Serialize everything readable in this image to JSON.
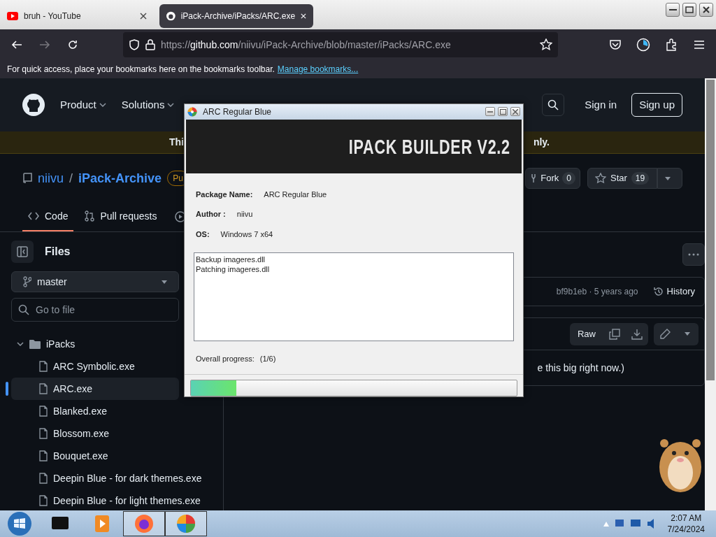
{
  "browser": {
    "tabs": [
      {
        "title": "bruh - YouTube",
        "selected": false
      },
      {
        "title": "iPack-Archive/iPacks/ARC.exe",
        "selected": true
      }
    ],
    "forward_disabled": true,
    "url": {
      "scheme": "https://",
      "host": "github.com",
      "path": "/niivu/iPack-Archive/blob/master/iPacks/ARC.exe"
    },
    "bookmarks_bar": {
      "message": "For quick access, place your bookmarks here on the bookmarks toolbar.",
      "link": "Manage bookmarks..."
    }
  },
  "github": {
    "nav": [
      {
        "label": "Product"
      },
      {
        "label": "Solutions"
      }
    ],
    "sign_in": "Sign in",
    "sign_up": "Sign up",
    "banner": {
      "text_start": "Thi",
      "text_end": "nly."
    },
    "repo": {
      "owner": "niivu",
      "separator": "/",
      "name": "iPack-Archive",
      "visibility": "Pu",
      "fork": {
        "label": "Fork",
        "count": "0"
      },
      "star": {
        "label": "Star",
        "count": "19"
      }
    },
    "tabs": [
      {
        "label": "Code",
        "selected": true
      },
      {
        "label": "Pull requests",
        "selected": false
      }
    ],
    "sidebar": {
      "title": "Files",
      "branch": "master",
      "search_placeholder": "Go to file",
      "tree": [
        {
          "name": "iPacks",
          "kind": "folder",
          "expanded": true,
          "selected": false,
          "children": [
            {
              "name": "ARC Symbolic.exe",
              "kind": "file",
              "selected": false
            },
            {
              "name": "ARC.exe",
              "kind": "file",
              "selected": true
            },
            {
              "name": "Blanked.exe",
              "kind": "file",
              "selected": false
            },
            {
              "name": "Blossom.exe",
              "kind": "file",
              "selected": false
            },
            {
              "name": "Bouquet.exe",
              "kind": "file",
              "selected": false
            },
            {
              "name": "Deepin Blue - for dark themes.exe",
              "kind": "file",
              "selected": false
            },
            {
              "name": "Deepin Blue - for light themes.exe",
              "kind": "file",
              "selected": false
            }
          ]
        }
      ]
    },
    "commit": {
      "text": "bf9b1eb · 5 years ago",
      "history": "History"
    },
    "file_toolbar": {
      "raw": "Raw"
    },
    "file_message": "e this big right now.)"
  },
  "dialog": {
    "title": "ARC Regular Blue",
    "banner": "IPACK BUILDER V2.2",
    "fields": [
      {
        "label": "Package Name:",
        "value": "ARC Regular Blue"
      },
      {
        "label": "Author :",
        "value": "niivu"
      },
      {
        "label": "OS:",
        "value": "Windows 7 x64"
      }
    ],
    "log": [
      "Backup imageres.dll",
      "Patching imageres.dll"
    ],
    "progress_label": "Overall progress:",
    "progress_count": "(1/6)",
    "level": 0.14
  },
  "taskbar": {
    "time": "2:07 AM",
    "date": "7/24/2024"
  }
}
